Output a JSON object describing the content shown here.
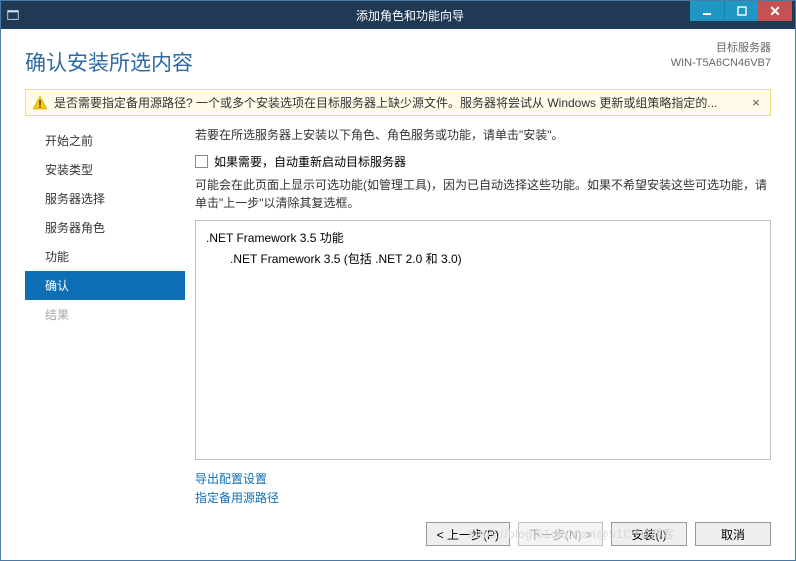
{
  "titlebar": {
    "title": "添加角色和功能向导"
  },
  "header": {
    "page_title": "确认安装所选内容",
    "target_label": "目标服务器",
    "target_value": "WIN-T5A6CN46VB7"
  },
  "warning": {
    "text": "是否需要指定备用源路径? 一个或多个安装选项在目标服务器上缺少源文件。服务器将尝试从 Windows 更新或组策略指定的...",
    "close": "×"
  },
  "sidebar": {
    "items": [
      {
        "label": "开始之前",
        "state": "normal"
      },
      {
        "label": "安装类型",
        "state": "normal"
      },
      {
        "label": "服务器选择",
        "state": "normal"
      },
      {
        "label": "服务器角色",
        "state": "normal"
      },
      {
        "label": "功能",
        "state": "normal"
      },
      {
        "label": "确认",
        "state": "active"
      },
      {
        "label": "结果",
        "state": "muted"
      }
    ]
  },
  "content": {
    "intro": "若要在所选服务器上安装以下角色、角色服务或功能，请单击\"安装\"。",
    "checkbox_label": "如果需要，自动重新启动目标服务器",
    "note": "可能会在此页面上显示可选功能(如管理工具)，因为已自动选择这些功能。如果不希望安装这些可选功能，请单击\"上一步\"以清除其复选框。",
    "features": {
      "parent": ".NET Framework 3.5 功能",
      "child": ".NET Framework 3.5 (包括 .NET 2.0 和 3.0)"
    },
    "links": {
      "export": "导出配置设置",
      "alt_source": "指定备用源路径"
    }
  },
  "footer": {
    "prev": "< 上一步(P)",
    "next": "下一步(N) >",
    "install": "安装(I)",
    "cancel": "取消"
  },
  "watermark": "https://blog.51cto.com@51CTO博客"
}
